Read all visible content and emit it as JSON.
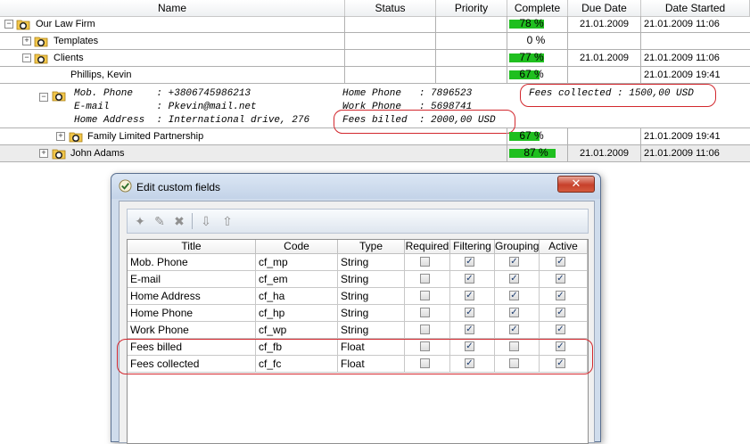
{
  "grid": {
    "columns": [
      "Name",
      "Status",
      "Priority",
      "Complete",
      "Due Date",
      "Date Started"
    ],
    "rows": [
      {
        "name": "Our Law Firm",
        "complete": "78 %",
        "progress": 0.78,
        "due": "21.01.2009",
        "started": "21.01.2009 11:06",
        "expander": "⊟"
      },
      {
        "name": "Templates",
        "complete": "0 %",
        "progress": 0,
        "due": "",
        "started": "",
        "expander": "⊞"
      },
      {
        "name": "Clients",
        "complete": "77 %",
        "progress": 0.77,
        "due": "21.01.2009",
        "started": "21.01.2009 11:06",
        "expander": "⊟"
      },
      {
        "name": "Phillips, Kevin",
        "complete": "67 %",
        "progress": 0.67,
        "due": "",
        "started": "21.01.2009 19:41",
        "expander": "⊟"
      },
      {
        "name": "Family Limited Partnership",
        "complete": "67 %",
        "progress": 0.67,
        "due": "",
        "started": "21.01.2009 19:41",
        "expander": "⊞"
      },
      {
        "name": "John Adams",
        "complete": "87 %",
        "progress": 0.87,
        "due": "21.01.2009",
        "started": "21.01.2009 11:06",
        "expander": "⊞"
      }
    ],
    "details": {
      "mob_phone": "Mob. Phone    : +3806745986213",
      "email": "E-mail        : Pkevin@mail.net",
      "home_address": "Home Address  : International drive, 276",
      "home_phone": "Home Phone   : 7896523",
      "work_phone": "Work Phone   : 5698741",
      "fees_billed": "Fees billed  : 2000,00 USD",
      "fees_collected": "Fees collected : 1500,00 USD"
    }
  },
  "dialog": {
    "title": "Edit custom fields",
    "close_label": "✕",
    "columns": [
      "Title",
      "Code",
      "Type",
      "Required",
      "Filtering",
      "Grouping",
      "Active"
    ],
    "fields": [
      {
        "title": "Mob. Phone",
        "code": "cf_mp",
        "type": "String",
        "required": false,
        "filtering": true,
        "grouping": true,
        "active": true
      },
      {
        "title": "E-mail",
        "code": "cf_em",
        "type": "String",
        "required": false,
        "filtering": true,
        "grouping": true,
        "active": true
      },
      {
        "title": "Home Address",
        "code": "cf_ha",
        "type": "String",
        "required": false,
        "filtering": true,
        "grouping": true,
        "active": true
      },
      {
        "title": "Home Phone",
        "code": "cf_hp",
        "type": "String",
        "required": false,
        "filtering": true,
        "grouping": true,
        "active": true
      },
      {
        "title": "Work Phone",
        "code": "cf_wp",
        "type": "String",
        "required": false,
        "filtering": true,
        "grouping": true,
        "active": true
      },
      {
        "title": "Fees billed",
        "code": "cf_fb",
        "type": "Float",
        "required": false,
        "filtering": true,
        "grouping": false,
        "active": true
      },
      {
        "title": "Fees collected",
        "code": "cf_fc",
        "type": "Float",
        "required": false,
        "filtering": true,
        "grouping": false,
        "active": true
      }
    ],
    "toolbar_icons": [
      "add-field-icon",
      "edit-field-icon",
      "delete-field-icon",
      "move-down-icon",
      "move-up-icon"
    ]
  },
  "colors": {
    "progress": "#1fbf1f",
    "highlight": "#d2282e",
    "dialog_frame": "#cfdcec"
  }
}
